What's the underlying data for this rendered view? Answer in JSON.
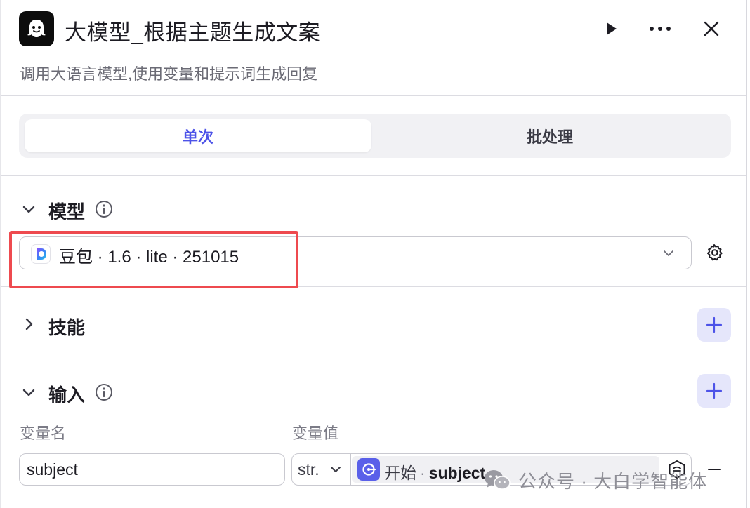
{
  "header": {
    "title": "大模型_根据主题生成文案",
    "description": "调用大语言模型,使用变量和提示词生成回复"
  },
  "tabs": [
    {
      "label": "单次",
      "active": true
    },
    {
      "label": "批处理",
      "active": false
    }
  ],
  "model_section": {
    "label": "模型",
    "selected_model": "豆包 · 1.6 · lite · 251015"
  },
  "skill_section": {
    "label": "技能"
  },
  "input_section": {
    "label": "输入",
    "col_name": "变量名",
    "col_value": "变量值",
    "rows": [
      {
        "name": "subject",
        "type": "str.",
        "ref_node": "开始",
        "ref_sep": "·",
        "ref_var": "subject"
      }
    ]
  },
  "watermark": "公众号 · 大白学智能体",
  "colors": {
    "accent": "#4d53e8",
    "highlight": "#ee4a4f",
    "add_button_bg": "#e5e6fb"
  },
  "icons": [
    "bot-icon",
    "play-icon",
    "more-icon",
    "close-icon",
    "chevron-down-icon",
    "chevron-right-icon",
    "info-icon",
    "doubao-logo-icon",
    "gear-icon",
    "plus-icon",
    "start-node-icon",
    "expression-icon",
    "minus-icon",
    "wechat-icon"
  ]
}
